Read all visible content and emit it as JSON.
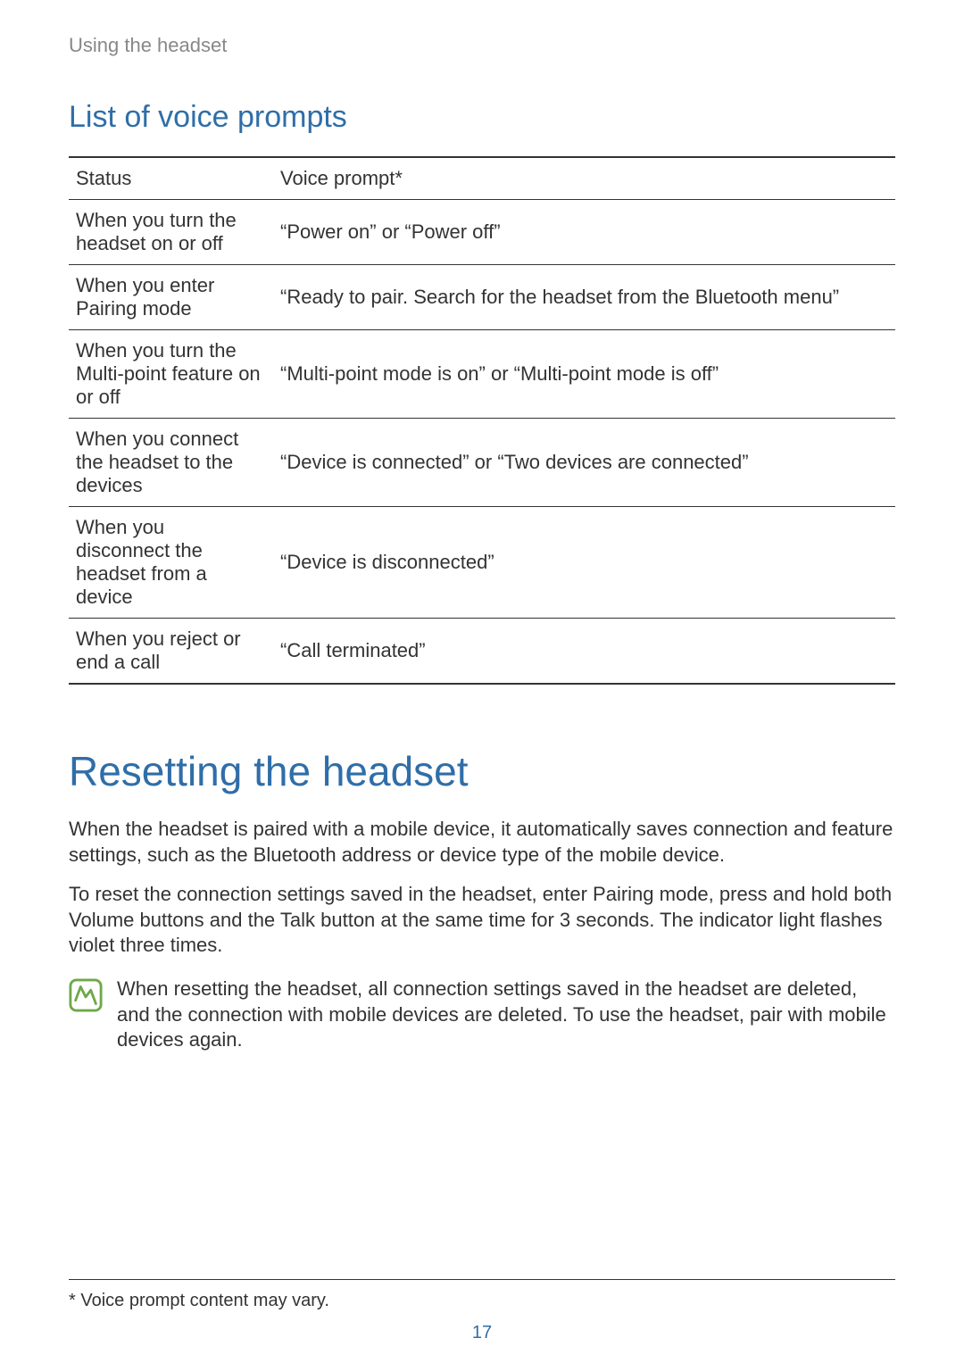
{
  "breadcrumb": "Using the headset",
  "section_heading": "List of voice prompts",
  "table": {
    "headers": {
      "status": "Status",
      "prompt": "Voice prompt*"
    },
    "rows": [
      {
        "status": "When you turn the headset on or off",
        "prompt": "“Power on” or “Power off”"
      },
      {
        "status": "When you enter Pairing mode",
        "prompt": "“Ready to pair. Search for the headset from the Bluetooth menu”"
      },
      {
        "status": "When you turn the Multi-point feature on or off",
        "prompt": "“Multi-point mode is on” or “Multi-point mode is off”"
      },
      {
        "status": "When you connect the headset to the devices",
        "prompt": "“Device is connected” or “Two devices are connected”"
      },
      {
        "status": "When you disconnect the headset from a device",
        "prompt": "“Device is disconnected”"
      },
      {
        "status": "When you reject or end a call",
        "prompt": "“Call terminated”"
      }
    ]
  },
  "main_heading": "Resetting the headset",
  "paragraphs": {
    "p1": "When the headset is paired with a mobile device, it automatically saves connection and feature settings, such as the Bluetooth address or device type of the mobile device.",
    "p2": "To reset the connection settings saved in the headset, enter Pairing mode, press and hold both Volume buttons and the Talk button at the same time for 3 seconds. The indicator light flashes violet three times."
  },
  "note": "When resetting the headset, all connection settings saved in the headset are deleted, and the connection with mobile devices are deleted. To use the headset, pair with mobile devices again.",
  "footnote": "* Voice prompt content may vary.",
  "page_number": "17",
  "colors": {
    "accent": "#2f6ea8",
    "body_text": "#333333",
    "muted": "#888888",
    "note_icon": "#6fa847"
  }
}
